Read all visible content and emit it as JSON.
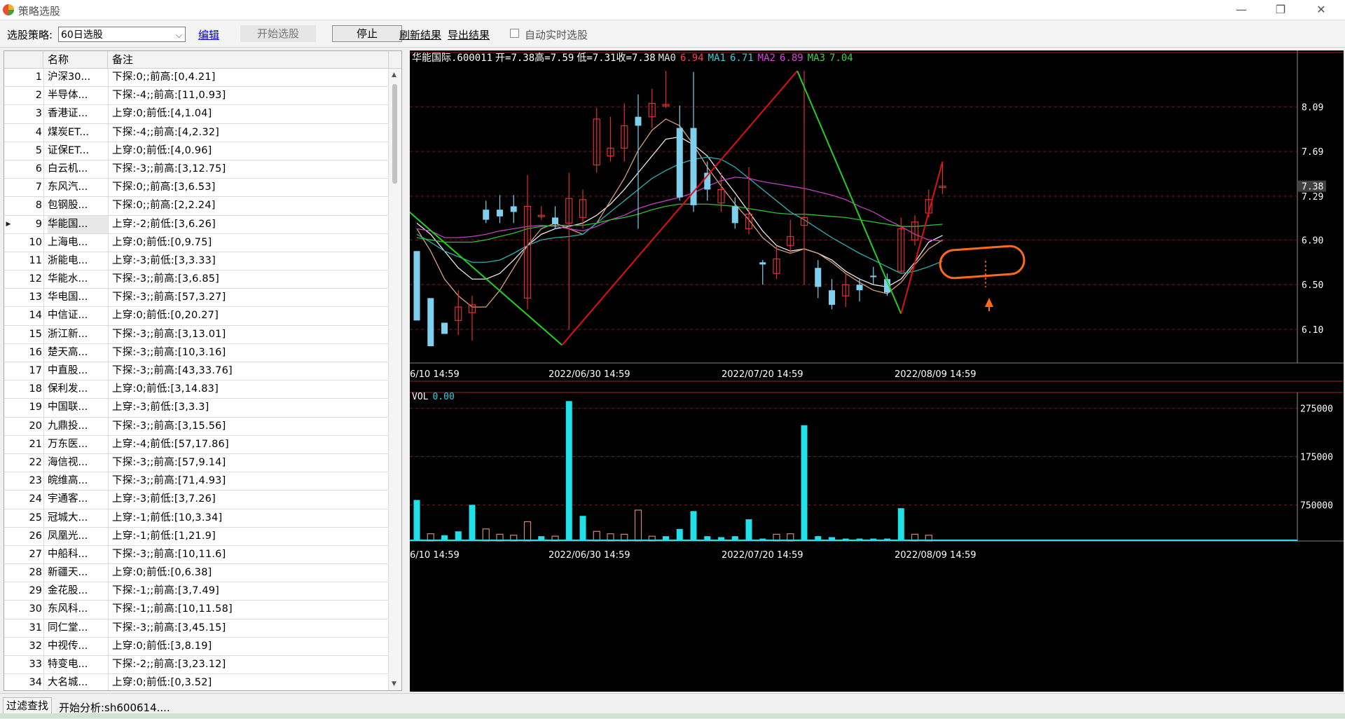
{
  "window": {
    "title": "策略选股",
    "controls": [
      "—",
      "❐",
      "✕"
    ]
  },
  "toolbar": {
    "strategy_label": "选股策略:",
    "strategy_value": "60日选股",
    "edit_label": "编辑",
    "start_label": "开始选股",
    "stop_label": "停止",
    "refresh_label": "刷新结果",
    "export_label": "导出结果",
    "auto_label": "自动实时选股",
    "auto_checked": false
  },
  "list": {
    "columns": [
      "名称",
      "备注"
    ],
    "selected_index": 8,
    "rows": [
      {
        "num": "1",
        "name": "沪深30...",
        "note": "下探:0;;前高:[0,4.21]"
      },
      {
        "num": "2",
        "name": "半导体...",
        "note": "下探:-4;;前高:[11,0.93]"
      },
      {
        "num": "3",
        "name": "香港证...",
        "note": "上穿:0;前低:[4,1.04]"
      },
      {
        "num": "4",
        "name": "煤炭ET...",
        "note": "下探:-4;;前高:[4,2.32]"
      },
      {
        "num": "5",
        "name": "证保ET...",
        "note": "上穿:0;前低:[4,0.96]"
      },
      {
        "num": "6",
        "name": "白云机...",
        "note": "下探:-3;;前高:[3,12.75]"
      },
      {
        "num": "7",
        "name": "东风汽...",
        "note": "下探:0;;前高:[3,6.53]"
      },
      {
        "num": "8",
        "name": "包钢股...",
        "note": "下探:0;;前高:[2,2.24]"
      },
      {
        "num": "9",
        "name": "华能国...",
        "note": "上穿:-2;前低:[3,6.26]"
      },
      {
        "num": "10",
        "name": "上海电...",
        "note": "上穿:0;前低:[0,9.75]"
      },
      {
        "num": "11",
        "name": "浙能电...",
        "note": "上穿:-3;前低:[3,3.33]"
      },
      {
        "num": "12",
        "name": "华能水...",
        "note": "下探:-3;;前高:[3,6.85]"
      },
      {
        "num": "13",
        "name": "华电国...",
        "note": "下探:-3;;前高:[57,3.27]"
      },
      {
        "num": "14",
        "name": "中信证...",
        "note": "上穿:0;前低:[0,20.27]"
      },
      {
        "num": "15",
        "name": "浙江新...",
        "note": "下探:-3;;前高:[3,13.01]"
      },
      {
        "num": "16",
        "name": "楚天高...",
        "note": "下探:-3;;前高:[10,3.16]"
      },
      {
        "num": "17",
        "name": "中直股...",
        "note": "下探:-3;;前高:[43,33.76]"
      },
      {
        "num": "18",
        "name": "保利发...",
        "note": "上穿:0;前低:[3,14.83]"
      },
      {
        "num": "19",
        "name": "中国联...",
        "note": "上穿:-3;前低:[3,3.3]"
      },
      {
        "num": "20",
        "name": "九鼎投...",
        "note": "下探:-3;;前高:[3,15.56]"
      },
      {
        "num": "21",
        "name": "万东医...",
        "note": "上穿:-4;前低:[57,17.86]"
      },
      {
        "num": "22",
        "name": "海信视...",
        "note": "下探:-3;;前高:[57,9.14]"
      },
      {
        "num": "23",
        "name": "皖维高...",
        "note": "下探:-3;;前高:[71,4.93]"
      },
      {
        "num": "24",
        "name": "宇通客...",
        "note": "上穿:-3;前低:[3,7.26]"
      },
      {
        "num": "25",
        "name": "冠城大...",
        "note": "上穿:-1;前低:[10,3.34]"
      },
      {
        "num": "26",
        "name": "凤凰光...",
        "note": "上穿:-1;前低:[1,21.9]"
      },
      {
        "num": "27",
        "name": "中船科...",
        "note": "下探:-3;;前高:[10,11.6]"
      },
      {
        "num": "28",
        "name": "新疆天...",
        "note": "上穿:0;前低:[0,6.38]"
      },
      {
        "num": "29",
        "name": "金花股...",
        "note": "下探:-1;;前高:[3,7.49]"
      },
      {
        "num": "30",
        "name": "东风科...",
        "note": "下探:-1;;前高:[10,11.58]"
      },
      {
        "num": "31",
        "name": "同仁堂...",
        "note": "下探:-3;;前高:[3,45.15]"
      },
      {
        "num": "32",
        "name": "中视传...",
        "note": "上穿:0;前低:[3,8.19]"
      },
      {
        "num": "33",
        "name": "特变电...",
        "note": "下探:-2;;前高:[3,23.12]"
      },
      {
        "num": "34",
        "name": "大名城...",
        "note": "上穿:0;前低:[0,3.52]"
      }
    ]
  },
  "chart_data": {
    "type": "candlestick",
    "info": {
      "name": "华能国际",
      "code": ".600011",
      "open_label": "开=7.38",
      "high_label": "高=7.59",
      "low_label": "低=7.31",
      "close_label": "收=7.38",
      "ma0_label": "MA0",
      "ma0_value": "6.94",
      "ma1_label": "MA1",
      "ma1_value": "6.71",
      "ma2_label": "MA2",
      "ma2_value": "6.89",
      "ma3_label": "MA3",
      "ma3_value": "7.04"
    },
    "price_ticks": [
      "8.09",
      "7.69",
      "7.29",
      "6.90",
      "6.50",
      "6.10"
    ],
    "price_tick_values": [
      8.09,
      7.69,
      7.29,
      6.9,
      6.5,
      6.1
    ],
    "price_range": [
      5.8,
      8.48
    ],
    "current_price": "7.38",
    "current_price_value": 7.38,
    "date_labels": [
      "6/10 14:59",
      "2022/06/30 14:59",
      "2022/07/20 14:59",
      "2022/08/09 14:59"
    ],
    "candles": [
      [
        6.8,
        6.18,
        6.28,
        6.8
      ],
      [
        6.38,
        5.95,
        6.08,
        6.2
      ],
      [
        6.16,
        6.06,
        6.08,
        6.14
      ],
      [
        6.18,
        6.3,
        6.05,
        6.45
      ],
      [
        6.25,
        6.32,
        6.0,
        6.4
      ],
      [
        7.17,
        7.08,
        7.05,
        7.25
      ],
      [
        7.17,
        7.11,
        7.05,
        7.3
      ],
      [
        7.2,
        7.15,
        7.05,
        7.3
      ],
      [
        6.38,
        7.2,
        6.28,
        7.48
      ],
      [
        7.12,
        7.12,
        7.08,
        7.2
      ],
      [
        7.1,
        7.04,
        7.0,
        7.2
      ],
      [
        7.05,
        7.27,
        6.1,
        7.5
      ],
      [
        7.1,
        7.26,
        7.0,
        7.35
      ],
      [
        7.57,
        7.98,
        7.5,
        8.08
      ],
      [
        7.65,
        7.72,
        7.6,
        8.0
      ],
      [
        7.72,
        7.92,
        7.6,
        8.12
      ],
      [
        8.0,
        7.92,
        7.0,
        8.2
      ],
      [
        8.0,
        8.12,
        7.9,
        8.25
      ],
      [
        8.1,
        8.11,
        8.08,
        8.41
      ],
      [
        7.9,
        7.28,
        7.25,
        8.1
      ],
      [
        7.9,
        7.21,
        7.15,
        8.4
      ],
      [
        7.5,
        7.35,
        7.25,
        7.6
      ],
      [
        7.23,
        7.35,
        7.15,
        7.5
      ],
      [
        7.2,
        7.05,
        7.0,
        7.28
      ],
      [
        7.0,
        7.13,
        6.95,
        7.55
      ],
      [
        6.7,
        6.68,
        6.5,
        6.72
      ],
      [
        6.6,
        6.73,
        6.55,
        6.85
      ],
      [
        6.85,
        6.93,
        6.78,
        7.08
      ],
      [
        7.03,
        7.1,
        6.5,
        8.41
      ],
      [
        6.65,
        6.48,
        6.38,
        6.72
      ],
      [
        6.45,
        6.32,
        6.28,
        6.55
      ],
      [
        6.4,
        6.5,
        6.3,
        6.6
      ],
      [
        6.5,
        6.45,
        6.35,
        6.55
      ],
      [
        6.58,
        6.57,
        6.5,
        6.66
      ],
      [
        6.55,
        6.43,
        6.4,
        6.6
      ],
      [
        6.62,
        7.0,
        6.6,
        7.1
      ],
      [
        6.9,
        7.06,
        6.85,
        7.12
      ],
      [
        7.14,
        7.26,
        7.1,
        7.35
      ],
      [
        7.37,
        7.38,
        7.31,
        7.59
      ]
    ],
    "ma_series": [
      {
        "name": "MA0",
        "color": "#e8e8e8",
        "values": [
          7.05,
          6.95,
          6.8,
          6.65,
          6.55,
          6.55,
          6.6,
          6.72,
          6.85,
          6.95,
          7.0,
          7.02,
          7.05,
          7.12,
          7.22,
          7.35,
          7.5,
          7.65,
          7.8,
          7.82,
          7.75,
          7.65,
          7.48,
          7.32,
          7.15,
          6.98,
          6.85,
          6.8,
          6.82,
          6.78,
          6.72,
          6.62,
          6.55,
          6.5,
          6.48,
          6.55,
          6.7,
          6.88,
          6.94
        ]
      },
      {
        "name": "MA1",
        "color": "#d4a07a",
        "values": [
          7.0,
          6.8,
          6.55,
          6.4,
          6.3,
          6.3,
          6.45,
          6.65,
          6.85,
          7.0,
          7.05,
          7.0,
          6.95,
          7.05,
          7.25,
          7.45,
          7.7,
          7.88,
          7.98,
          7.92,
          7.75,
          7.55,
          7.38,
          7.22,
          7.08,
          6.92,
          6.82,
          6.78,
          6.82,
          6.78,
          6.7,
          6.6,
          6.52,
          6.45,
          6.42,
          6.52,
          6.68,
          6.82,
          6.9
        ]
      },
      {
        "name": "MA2",
        "color": "#2bb0b0",
        "values": [
          6.95,
          6.88,
          6.8,
          6.75,
          6.7,
          6.7,
          6.72,
          6.78,
          6.85,
          6.9,
          6.92,
          6.93,
          6.95,
          7.05,
          7.15,
          7.25,
          7.35,
          7.45,
          7.52,
          7.58,
          7.62,
          7.64,
          7.62,
          7.55,
          7.45,
          7.35,
          7.25,
          7.15,
          7.08,
          7.0,
          6.92,
          6.85,
          6.78,
          6.72,
          6.66,
          6.6,
          6.62,
          6.66,
          6.71
        ]
      },
      {
        "name": "MA3",
        "color": "#c040c0",
        "values": [
          7.0,
          6.98,
          6.92,
          6.92,
          6.93,
          6.95,
          6.98,
          7.0,
          7.02,
          7.03,
          7.02,
          7.0,
          6.98,
          7.02,
          7.08,
          7.12,
          7.18,
          7.22,
          7.25,
          7.28,
          7.32,
          7.38,
          7.43,
          7.46,
          7.45,
          7.42,
          7.4,
          7.38,
          7.36,
          7.33,
          7.3,
          7.26,
          7.2,
          7.15,
          7.08,
          7.02,
          6.95,
          6.9,
          6.89
        ]
      },
      {
        "name": "MA4",
        "color": "#30c030",
        "values": [
          6.92,
          6.9,
          6.88,
          6.88,
          6.88,
          6.9,
          6.93,
          6.96,
          7.0,
          7.02,
          7.03,
          7.03,
          7.03,
          7.05,
          7.08,
          7.1,
          7.13,
          7.17,
          7.2,
          7.22,
          7.22,
          7.22,
          7.21,
          7.2,
          7.18,
          7.16,
          7.14,
          7.13,
          7.13,
          7.12,
          7.11,
          7.1,
          7.08,
          7.06,
          7.04,
          7.02,
          7.02,
          7.03,
          7.04
        ]
      }
    ],
    "zigzag": [
      {
        "i": -1,
        "v": 7.2,
        "color": "#20d020"
      },
      {
        "i": 10.5,
        "v": 5.96,
        "color": "#e01010"
      },
      {
        "i": 27.5,
        "v": 8.41,
        "color": "#20d020"
      },
      {
        "i": 35,
        "v": 6.24,
        "color": "#e01010"
      },
      {
        "i": 38,
        "v": 7.6
      }
    ],
    "volume": {
      "label": "VOL",
      "value": "0.00",
      "ticks": [
        "275000",
        "175000",
        "750000"
      ],
      "tick_values": [
        275000,
        175000,
        75000
      ],
      "range": [
        0,
        305000
      ],
      "values": [
        85000,
        15000,
        12000,
        20000,
        75000,
        25000,
        14000,
        12000,
        40000,
        10000,
        10000,
        290000,
        52000,
        20000,
        15000,
        14000,
        64000,
        10000,
        10000,
        25000,
        62000,
        10000,
        8000,
        10000,
        45000,
        5000,
        14000,
        15000,
        240000,
        10000,
        8000,
        5000,
        5000,
        5000,
        5000,
        68000,
        14000,
        12000,
        0
      ],
      "rising": [
        false,
        true,
        false,
        false,
        false,
        true,
        true,
        true,
        true,
        false,
        true,
        false,
        false,
        true,
        true,
        true,
        true,
        true,
        false,
        false,
        false,
        false,
        false,
        false,
        false,
        false,
        true,
        true,
        false,
        false,
        false,
        false,
        false,
        false,
        false,
        false,
        true,
        true,
        true
      ]
    }
  }
}
